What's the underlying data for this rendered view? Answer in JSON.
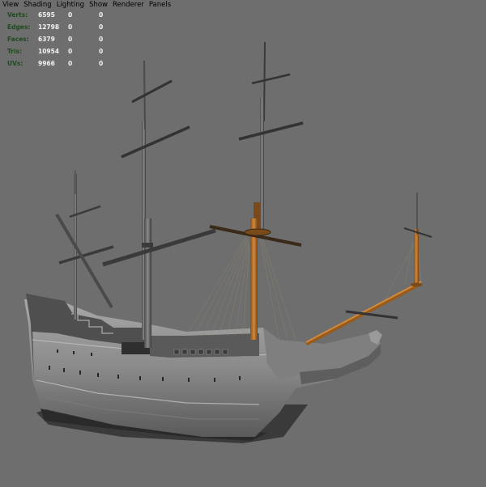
{
  "menubar": {
    "items": [
      {
        "label": "View"
      },
      {
        "label": "Shading"
      },
      {
        "label": "Lighting"
      },
      {
        "label": "Show"
      },
      {
        "label": "Renderer"
      },
      {
        "label": "Panels"
      }
    ]
  },
  "hud": {
    "rows": [
      {
        "label": "Verts:",
        "total": "6595",
        "selected": "0",
        "components": "0"
      },
      {
        "label": "Edges:",
        "total": "12798",
        "selected": "0",
        "components": "0"
      },
      {
        "label": "Faces:",
        "total": "6379",
        "selected": "0",
        "components": "0"
      },
      {
        "label": "Tris:",
        "total": "10954",
        "selected": "0",
        "components": "0"
      },
      {
        "label": "UVs:",
        "total": "9966",
        "selected": "0",
        "components": "0"
      }
    ]
  },
  "colors": {
    "viewport_bg": "#6e6e6e",
    "hud_label": "#1e4a1e",
    "hud_value": "#f2f2f2",
    "selected_wireframe": "#c07a2c"
  },
  "scene": {
    "model": "sailing-ship",
    "shading": "smooth-shaded"
  }
}
